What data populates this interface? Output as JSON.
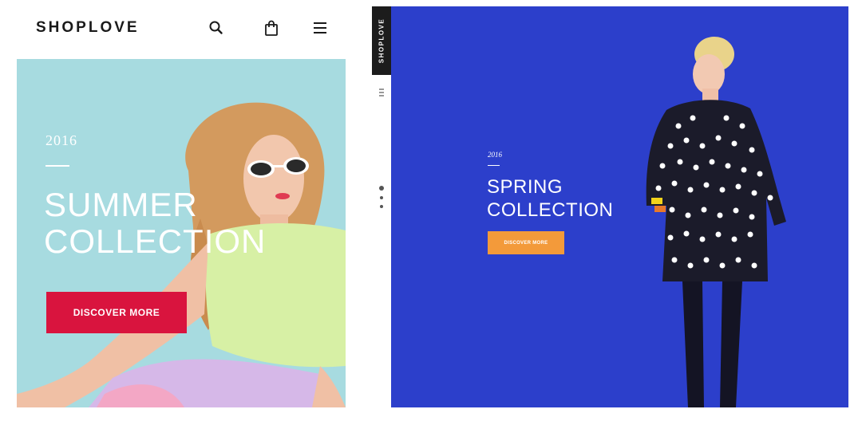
{
  "mobile": {
    "header": {
      "logo": "SHOPLOVE",
      "icons": [
        "search-icon",
        "shopping-bag-icon",
        "hamburger-menu-icon"
      ]
    },
    "hero": {
      "year": "2016",
      "title_line1": "SUMMER",
      "title_line2": "COLLECTION",
      "cta_label": "DISCOVER MORE",
      "background_color": "#a7dbe0",
      "cta_color": "#d9143e"
    }
  },
  "desktop": {
    "sidebar": {
      "brand": "SHOPLOVE",
      "icons": [
        "menu-icon"
      ],
      "slide_dots": 3,
      "active_dot": 0
    },
    "hero": {
      "year": "2016",
      "title_line1": "SPRING",
      "title_line2": "COLLECTION",
      "cta_label": "DISCOVER MORE",
      "background_color": "#2c3fcb",
      "cta_color": "#f39a3a"
    }
  }
}
